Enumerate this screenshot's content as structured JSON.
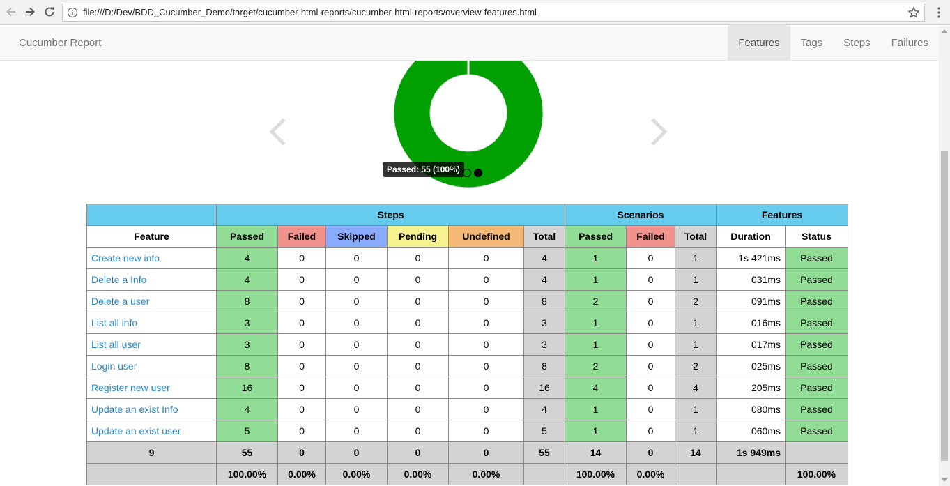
{
  "browser": {
    "url": "file:///D:/Dev/BDD_Cucumber_Demo/target/cucumber-html-reports/cucumber-html-reports/overview-features.html"
  },
  "navbar": {
    "brand": "Cucumber Report",
    "links": [
      {
        "label": "Features",
        "active": true
      },
      {
        "label": "Tags",
        "active": false
      },
      {
        "label": "Steps",
        "active": false
      },
      {
        "label": "Failures",
        "active": false
      }
    ]
  },
  "chart_data": {
    "type": "pie",
    "categories": [
      "Passed"
    ],
    "values": [
      55
    ],
    "colors": {
      "passed": "#00a000"
    },
    "tooltip": "Passed: 55 (100%)"
  },
  "table": {
    "group_headers": {
      "steps": "Steps",
      "scenarios": "Scenarios",
      "features": "Features"
    },
    "columns": {
      "feature": "Feature",
      "steps_passed": "Passed",
      "steps_failed": "Failed",
      "steps_skipped": "Skipped",
      "steps_pending": "Pending",
      "steps_undefined": "Undefined",
      "steps_total": "Total",
      "sc_passed": "Passed",
      "sc_failed": "Failed",
      "sc_total": "Total",
      "duration": "Duration",
      "status": "Status"
    },
    "rows": [
      {
        "feature": "Create new info",
        "passed": "4",
        "failed": "0",
        "skipped": "0",
        "pending": "0",
        "undefined": "0",
        "total": "4",
        "sc_passed": "1",
        "sc_failed": "0",
        "sc_total": "1",
        "duration": "1s 421ms",
        "status": "Passed"
      },
      {
        "feature": "Delete a Info",
        "passed": "4",
        "failed": "0",
        "skipped": "0",
        "pending": "0",
        "undefined": "0",
        "total": "4",
        "sc_passed": "1",
        "sc_failed": "0",
        "sc_total": "1",
        "duration": "031ms",
        "status": "Passed"
      },
      {
        "feature": "Delete a user",
        "passed": "8",
        "failed": "0",
        "skipped": "0",
        "pending": "0",
        "undefined": "0",
        "total": "8",
        "sc_passed": "2",
        "sc_failed": "0",
        "sc_total": "2",
        "duration": "091ms",
        "status": "Passed"
      },
      {
        "feature": "List all info",
        "passed": "3",
        "failed": "0",
        "skipped": "0",
        "pending": "0",
        "undefined": "0",
        "total": "3",
        "sc_passed": "1",
        "sc_failed": "0",
        "sc_total": "1",
        "duration": "016ms",
        "status": "Passed"
      },
      {
        "feature": "List all user",
        "passed": "3",
        "failed": "0",
        "skipped": "0",
        "pending": "0",
        "undefined": "0",
        "total": "3",
        "sc_passed": "1",
        "sc_failed": "0",
        "sc_total": "1",
        "duration": "017ms",
        "status": "Passed"
      },
      {
        "feature": "Login user",
        "passed": "8",
        "failed": "0",
        "skipped": "0",
        "pending": "0",
        "undefined": "0",
        "total": "8",
        "sc_passed": "2",
        "sc_failed": "0",
        "sc_total": "2",
        "duration": "025ms",
        "status": "Passed"
      },
      {
        "feature": "Register new user",
        "passed": "16",
        "failed": "0",
        "skipped": "0",
        "pending": "0",
        "undefined": "0",
        "total": "16",
        "sc_passed": "4",
        "sc_failed": "0",
        "sc_total": "4",
        "duration": "205ms",
        "status": "Passed"
      },
      {
        "feature": "Update an exist Info",
        "passed": "4",
        "failed": "0",
        "skipped": "0",
        "pending": "0",
        "undefined": "0",
        "total": "4",
        "sc_passed": "1",
        "sc_failed": "0",
        "sc_total": "1",
        "duration": "080ms",
        "status": "Passed"
      },
      {
        "feature": "Update an exist user",
        "passed": "5",
        "failed": "0",
        "skipped": "0",
        "pending": "0",
        "undefined": "0",
        "total": "5",
        "sc_passed": "1",
        "sc_failed": "0",
        "sc_total": "1",
        "duration": "060ms",
        "status": "Passed"
      }
    ],
    "totals": {
      "feature": "9",
      "passed": "55",
      "failed": "0",
      "skipped": "0",
      "pending": "0",
      "undefined": "0",
      "total": "55",
      "sc_passed": "14",
      "sc_failed": "0",
      "sc_total": "14",
      "duration": "1s 949ms",
      "status": ""
    },
    "percentages": {
      "passed": "100.00%",
      "failed": "0.00%",
      "skipped": "0.00%",
      "pending": "0.00%",
      "undefined": "0.00%",
      "sc_passed": "100.00%",
      "sc_failed": "0.00%",
      "status": "100.00%"
    }
  }
}
